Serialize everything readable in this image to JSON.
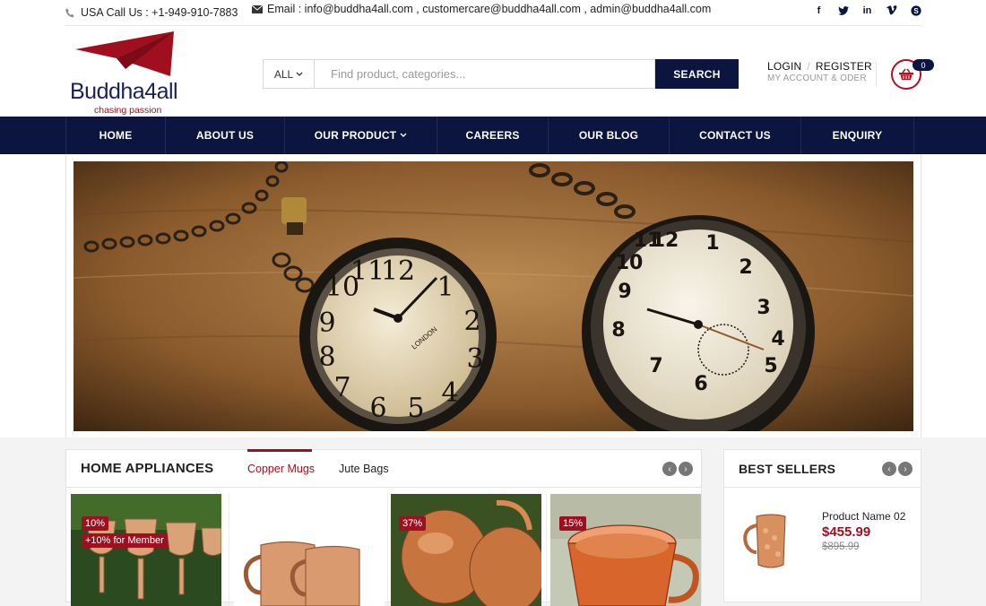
{
  "topbar": {
    "phone": "USA Call Us : +1-949-910-7883",
    "email": "Email : info@buddha4all.com , customercare@buddha4all.com , admin@buddha4all.com",
    "social_icons": [
      "facebook-icon",
      "twitter-icon",
      "linkedin-icon",
      "vimeo-icon",
      "skype-icon"
    ]
  },
  "logo": {
    "name": "Buddha4all",
    "tagline": "chasing passion"
  },
  "search": {
    "category": "ALL",
    "placeholder": "Find product, categories...",
    "button": "SEARCH"
  },
  "account": {
    "login": "LOGIN",
    "register": "REGISTER",
    "sub": "MY ACCOUNT & ODER"
  },
  "cart": {
    "count": "0"
  },
  "nav": {
    "items": [
      {
        "label": "HOME"
      },
      {
        "label": "ABOUT US"
      },
      {
        "label": "OUR PRODUCT"
      },
      {
        "label": "CAREERS"
      },
      {
        "label": "OUR BLOG"
      },
      {
        "label": "CONTACT US"
      },
      {
        "label": "ENQUIRY"
      }
    ]
  },
  "panel": {
    "title": "HOME APPLIANCES",
    "tabs": [
      {
        "label": "Copper Mugs"
      },
      {
        "label": "Jute Bags"
      }
    ],
    "products": [
      {
        "badge1": "10%",
        "badge2": "+10% for Member"
      },
      {
        "badge1": ""
      },
      {
        "badge1": "37%"
      },
      {
        "badge1": "15%"
      }
    ]
  },
  "best": {
    "title": "BEST SELLERS",
    "item": {
      "name": "Product Name 02",
      "price": "$455.99",
      "old_price": "$895.99"
    }
  },
  "colors": {
    "brand_navy": "#0c1540",
    "brand_red": "#a00f1f"
  }
}
